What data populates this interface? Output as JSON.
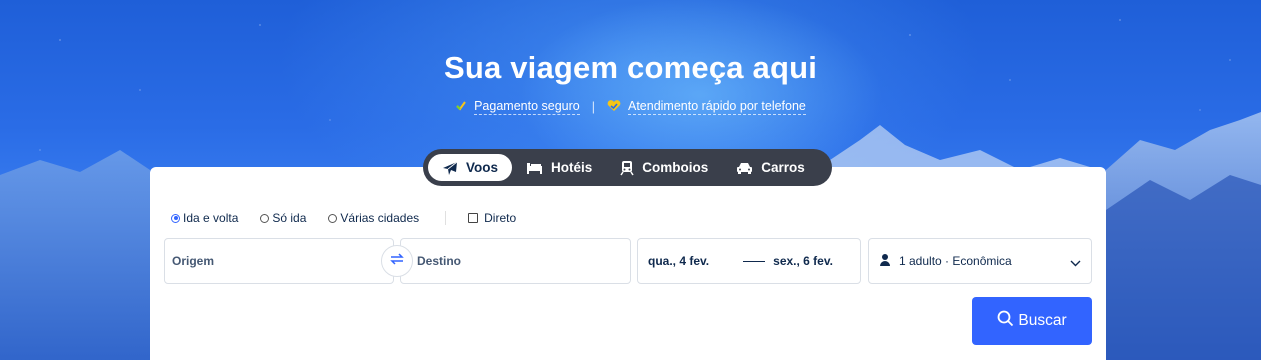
{
  "hero": {
    "title": "Sua viagem começa aqui",
    "badges": [
      {
        "label": "Pagamento seguro",
        "icon": "shield-check-icon"
      },
      {
        "label": "Atendimento rápido por telefone",
        "icon": "heart-check-icon"
      }
    ],
    "separator": "|"
  },
  "tabs": [
    {
      "label": "Voos",
      "icon": "airplane-icon",
      "active": true
    },
    {
      "label": "Hotéis",
      "icon": "bed-icon",
      "active": false
    },
    {
      "label": "Comboios",
      "icon": "train-icon",
      "active": false
    },
    {
      "label": "Carros",
      "icon": "car-icon",
      "active": false
    }
  ],
  "trip_type": {
    "options": [
      {
        "label": "Ida e volta",
        "selected": true
      },
      {
        "label": "Só ida",
        "selected": false
      },
      {
        "label": "Várias cidades",
        "selected": false
      }
    ],
    "direct_label": "Direto",
    "direct_checked": false
  },
  "search_form": {
    "origin_placeholder": "Origem",
    "destination_placeholder": "Destino",
    "depart_date": "qua., 4 fev.",
    "return_date": "sex., 6 fev.",
    "passengers": "1 adulto · Econômica",
    "search_label": "Buscar"
  },
  "colors": {
    "accent": "#3264ff",
    "tab_bar": "#3a3f4b",
    "text_dark": "#0f294d",
    "badge_check_green": "#7ed321",
    "badge_check_yellow": "#f5c518"
  }
}
